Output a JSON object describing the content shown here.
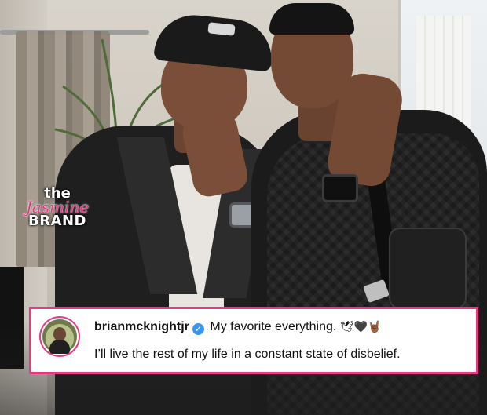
{
  "watermark": {
    "line1": "the",
    "line2": "Jasmine",
    "line3": "BRAND"
  },
  "caption": {
    "username": "brianmcknightjr",
    "verified_icon": "verified-badge-icon",
    "text": "My favorite everything.",
    "emojis": "🕊🖤🤘🏾",
    "line2": "I’ll live the rest of my life in a constant state of disbelief."
  },
  "colors": {
    "accent": "#e83a83",
    "verified": "#3897f0"
  }
}
